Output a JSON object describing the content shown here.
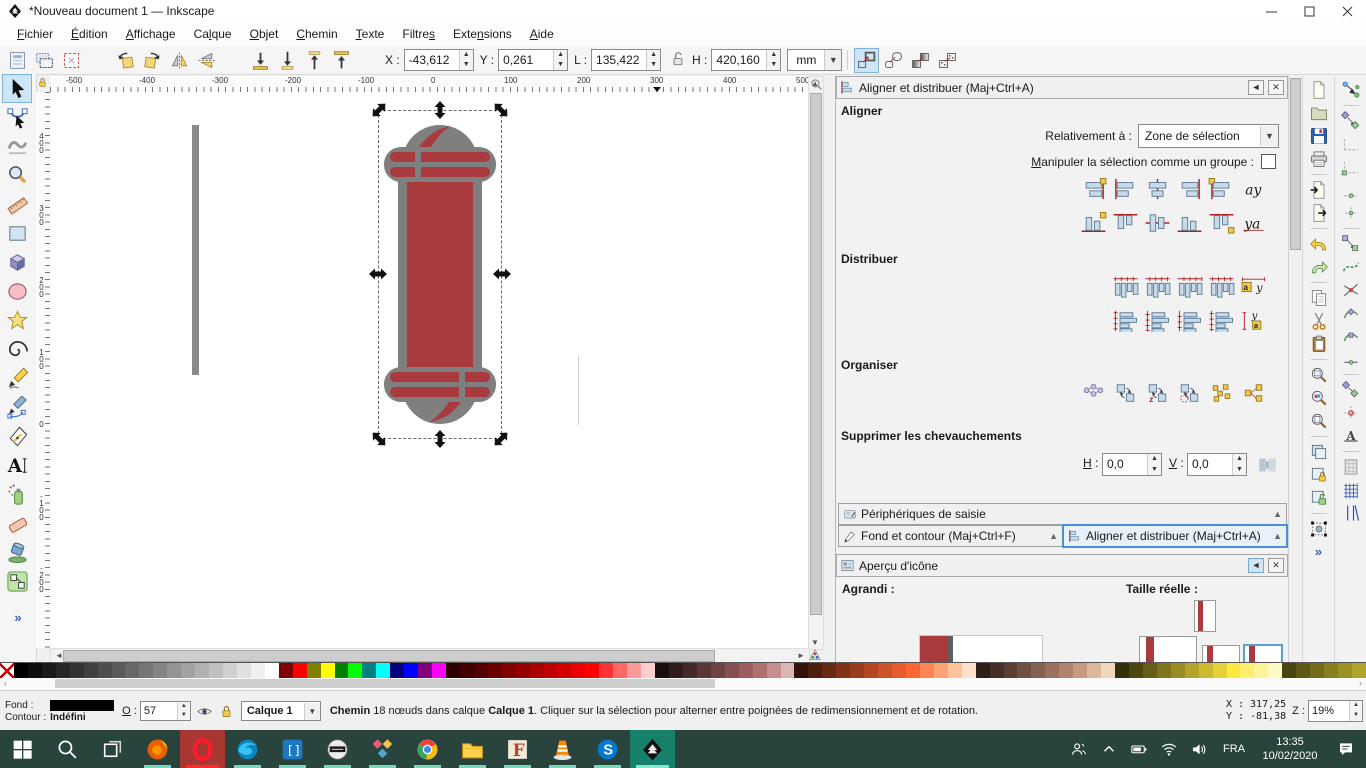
{
  "window": {
    "title": "*Nouveau document 1 — Inkscape"
  },
  "menubar": {
    "items": [
      {
        "label": "Fichier",
        "u": 0
      },
      {
        "label": "Édition",
        "u": 0
      },
      {
        "label": "Affichage",
        "u": 0
      },
      {
        "label": "Calque",
        "u": 2
      },
      {
        "label": "Objet",
        "u": 0
      },
      {
        "label": "Chemin",
        "u": 0
      },
      {
        "label": "Texte",
        "u": 0
      },
      {
        "label": "Filtres",
        "u": 6
      },
      {
        "label": "Extensions",
        "u": 4
      },
      {
        "label": "Aide",
        "u": 0
      }
    ]
  },
  "toolbar": {
    "left_icons": [
      "select-all",
      "select-all-in-all-layers",
      "deselect",
      "sep",
      "rotate-ccw",
      "rotate-cw",
      "flip-horizontal",
      "flip-vertical",
      "sep",
      "lower-to-bottom",
      "lower",
      "raise",
      "raise-to-top",
      "sep"
    ],
    "x_label": "X :",
    "x_value": "-43,612",
    "y_label": "Y :",
    "y_value": "0,261",
    "w_label": "L :",
    "w_value": "135,422",
    "h_label": "H :",
    "h_value": "420,160",
    "unit": "mm",
    "toggles": [
      {
        "name": "scale-stroke-with-object",
        "active": true
      },
      {
        "name": "scale-rounded-corners",
        "active": false
      },
      {
        "name": "transform-gradients",
        "active": false
      },
      {
        "name": "transform-patterns",
        "active": false
      }
    ]
  },
  "toolbox": {
    "tools": [
      {
        "name": "selector",
        "active": true
      },
      {
        "name": "node-editor"
      },
      {
        "name": "tweak"
      },
      {
        "name": "zoom"
      },
      {
        "name": "measure"
      },
      {
        "name": "rectangle"
      },
      {
        "name": "box-3d"
      },
      {
        "name": "ellipse"
      },
      {
        "name": "star"
      },
      {
        "name": "spiral"
      },
      {
        "name": "pencil"
      },
      {
        "name": "pen"
      },
      {
        "name": "calligraphy"
      },
      {
        "name": "text"
      },
      {
        "name": "spray"
      },
      {
        "name": "eraser"
      },
      {
        "name": "paint-bucket"
      },
      {
        "name": "connector"
      }
    ],
    "more_label": "»"
  },
  "rulers": {
    "h_labels": [
      "-500",
      "-400",
      "-300",
      "-200",
      "-100",
      "0",
      "100",
      "200",
      "300",
      "400",
      "500"
    ],
    "v_labels": [
      "400",
      "300",
      "200",
      "100",
      "0",
      "-100",
      "-200"
    ]
  },
  "canvas": {
    "colors": {
      "shape_red": "#a93a3e",
      "shape_gray": "#7f7f7f",
      "thin_bar_gray": "#8a8a8a"
    }
  },
  "dock": {
    "align_panel": {
      "title": "Aligner et distribuer (Maj+Ctrl+A)",
      "section_align": "Aligner",
      "relative_label": "Relativement à :",
      "relative_value": "Zone de sélection",
      "group_label": {
        "label": "Manipuler la sélection comme un groupe :",
        "u": 0
      },
      "align_row1": [
        "align-right-to-anchor-left",
        "align-left-edges",
        "align-center-vertical",
        "align-right-edges",
        "align-left-to-anchor-right",
        "align-text-anchor-horizontal"
      ],
      "align_row2": [
        "align-bottom-to-anchor-top",
        "align-top-edges",
        "align-center-horizontal",
        "align-bottom-edges",
        "align-top-to-anchor-bottom",
        "align-text-anchor-vertical"
      ],
      "section_distribute": "Distribuer",
      "distribute_row1": [
        "distribute-left-edges",
        "distribute-centers-horizontal",
        "distribute-right-edges",
        "distribute-equal-horizontal-gaps",
        "distribute-text-horizontal"
      ],
      "distribute_row2": [
        "distribute-top-edges",
        "distribute-centers-vertical",
        "distribute-bottom-edges",
        "distribute-equal-vertical-gaps",
        "distribute-text-vertical"
      ],
      "section_rearrange": "Organiser",
      "rearrange_icons": [
        "arrange-as-graph",
        "exchange-positions",
        "exchange-positions-zorder",
        "exchange-positions-clockwise",
        "randomize-positions",
        "unclump"
      ],
      "section_remove_overlaps": "Supprimer les chevauchements",
      "h_label": {
        "label": "H :",
        "u": 0
      },
      "h_value": "0,0",
      "v_label": {
        "label": "V :",
        "u": 0
      },
      "v_value": "0,0"
    },
    "collapsed_panels": {
      "input_devices": "Périphériques de saisie",
      "fill_stroke": "Fond et contour (Maj+Ctrl+F)",
      "align_distribute": "Aligner et distribuer (Maj+Ctrl+A)"
    },
    "icon_preview": {
      "title": "Aperçu d'icône",
      "magnified_label": "Agrandi :",
      "actual_label": "Taille réelle :"
    }
  },
  "commands_bar": {
    "icons": [
      "new-document",
      "open",
      "save",
      "print",
      "sep",
      "import",
      "export",
      "sep",
      "undo",
      "redo",
      "sep",
      "copy",
      "cut",
      "paste",
      "sep",
      "zoom-selection",
      "zoom-drawing",
      "zoom-page",
      "sep",
      "duplicate",
      "create-clone",
      "unlink-clone",
      "sep",
      "select-all-objects",
      "more"
    ]
  },
  "snap_bar": {
    "icons": [
      "snap-enabled",
      "sep",
      "snap-bbox",
      "snap-bbox-edges",
      "snap-bbox-corners",
      "snap-bbox-edge-midpoints",
      "snap-bbox-centers",
      "sep",
      "snap-nodes",
      "snap-paths",
      "snap-path-intersections",
      "snap-cusp-nodes",
      "snap-smooth-nodes",
      "snap-line-midpoints",
      "sep",
      "snap-object-centers",
      "snap-rotation-centers",
      "snap-text-baselines",
      "sep",
      "snap-page-border",
      "snap-grids",
      "snap-guides"
    ]
  },
  "palette": {
    "colors": [
      "none",
      "#000000",
      "#0d0d0d",
      "#1a1a1a",
      "#262626",
      "#333333",
      "#404040",
      "#4d4d4d",
      "#5a5a5a",
      "#686868",
      "#767676",
      "#848484",
      "#939393",
      "#a2a2a2",
      "#b1b1b1",
      "#c0c0c0",
      "#d0d0d0",
      "#e0e0e0",
      "#f0f0f0",
      "#ffffff",
      "#800000",
      "#ff0000",
      "#808000",
      "#ffff00",
      "#008000",
      "#00ff00",
      "#008080",
      "#00ffff",
      "#000080",
      "#0000ff",
      "#800080",
      "#ff00ff",
      "#2b0000",
      "#400000",
      "#550000",
      "#6a0000",
      "#800000",
      "#950000",
      "#aa0000",
      "#bf0000",
      "#d40000",
      "#ea0000",
      "#ff0000",
      "#ff3333",
      "#ff6666",
      "#ff9999",
      "#ffcccc",
      "#1a0f0f",
      "#301c1c",
      "#452929",
      "#5b3636",
      "#704343",
      "#865050",
      "#9b5d5d",
      "#b17070",
      "#c68f8f",
      "#dcb5b5",
      "#33140a",
      "#4d1f0f",
      "#662914",
      "#803319",
      "#993d1f",
      "#b34724",
      "#cc5229",
      "#e65c2e",
      "#ff6633",
      "#ff8555",
      "#ffa377",
      "#ffc29a",
      "#ffe0cc",
      "#2e2018",
      "#443026",
      "#5a4034",
      "#705042",
      "#866050",
      "#9c705e",
      "#b2826c",
      "#c89a80",
      "#deb69a",
      "#f0d6bc",
      "#33300a",
      "#4c4710",
      "#665e17",
      "#80751d",
      "#998c24",
      "#b3a32a",
      "#ccba31",
      "#e6d137",
      "#ffe83e",
      "#ffee6b",
      "#fff399",
      "#fff9c6",
      "#4a4510",
      "#5e5815",
      "#726b1a",
      "#867e1f",
      "#9a9124",
      "#aea429"
    ]
  },
  "statusbar": {
    "fill_label": "Fond :",
    "fill_value_color": "#000000",
    "stroke_label": "Contour :",
    "stroke_value": "Indéfini",
    "opacity_label": {
      "label": "O :",
      "u": 0
    },
    "opacity_value": "57",
    "layer_name": "Calque 1",
    "message": [
      {
        "text": "Chemin",
        "bold": true
      },
      {
        "text": " 18 nœuds dans calque ",
        "bold": false
      },
      {
        "text": "Calque 1",
        "bold": true
      },
      {
        "text": ". Cliquer sur la sélection pour alterner entre poignées de redimensionnement et de rotation.",
        "bold": false
      }
    ],
    "x_label": "X :",
    "x_value": "317,25",
    "y_label": "Y :",
    "y_value": "-81,38",
    "z_label": "Z :",
    "zoom_value": "19%"
  },
  "taskbar": {
    "items": [
      {
        "name": "start"
      },
      {
        "name": "search"
      },
      {
        "name": "task-view"
      },
      {
        "name": "firefox",
        "run": true
      },
      {
        "name": "opera",
        "opera_active": true
      },
      {
        "name": "edge",
        "run": true
      },
      {
        "name": "brackets",
        "run": true
      },
      {
        "name": "round-logo",
        "run": true
      },
      {
        "name": "diagram",
        "run": true
      },
      {
        "name": "chrome",
        "run": true
      },
      {
        "name": "file-explorer",
        "run": true
      },
      {
        "name": "f-serif",
        "run": true
      },
      {
        "name": "vlc",
        "run": true
      },
      {
        "name": "skype",
        "run": true
      },
      {
        "name": "inkscape",
        "inkscape_active": true
      }
    ],
    "tray": {
      "language": "FRA",
      "time": "13:35",
      "date": "10/02/2020",
      "icons": [
        "people",
        "chevron-up",
        "battery",
        "wifi",
        "volume"
      ],
      "notification": "notifications"
    }
  }
}
